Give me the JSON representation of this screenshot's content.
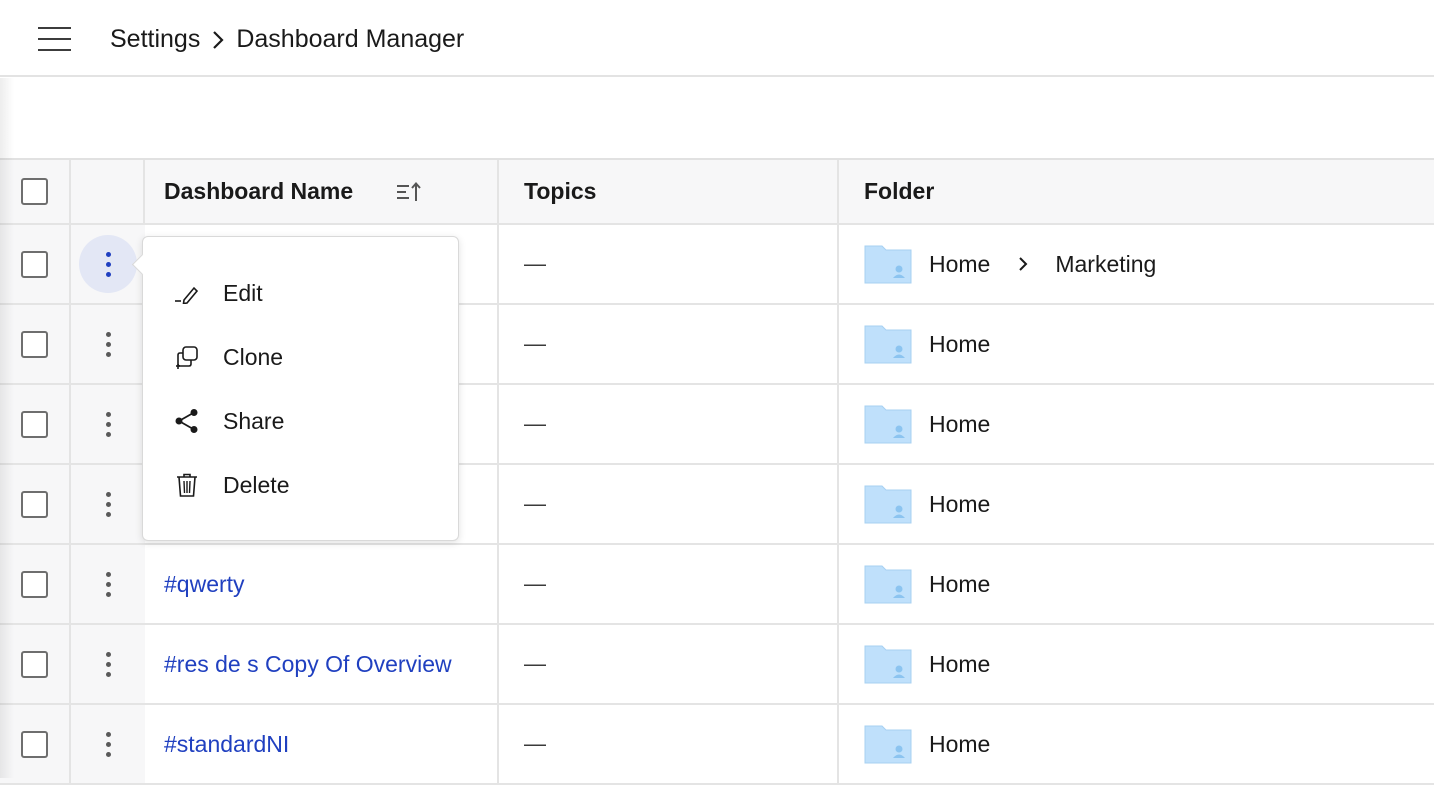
{
  "header": {
    "breadcrumb": [
      "Settings",
      "Dashboard Manager"
    ]
  },
  "table": {
    "columns": {
      "name": "Dashboard Name",
      "topics": "Topics",
      "folder": "Folder"
    },
    "rows": [
      {
        "name": "",
        "topics": "—",
        "folder": [
          "Home",
          "Marketing"
        ]
      },
      {
        "name": "",
        "topics": "—",
        "folder": [
          "Home"
        ]
      },
      {
        "name": "",
        "topics": "—",
        "folder": [
          "Home"
        ]
      },
      {
        "name": "",
        "topics": "—",
        "folder": [
          "Home"
        ]
      },
      {
        "name": "#qwerty",
        "topics": "—",
        "folder": [
          "Home"
        ]
      },
      {
        "name": "#res de s Copy Of Overview",
        "topics": "—",
        "folder": [
          "Home"
        ]
      },
      {
        "name": "#standardNI",
        "topics": "—",
        "folder": [
          "Home"
        ]
      }
    ]
  },
  "context_menu": {
    "items": [
      {
        "label": "Edit",
        "icon": "pencil-icon"
      },
      {
        "label": "Clone",
        "icon": "clone-icon"
      },
      {
        "label": "Share",
        "icon": "share-icon"
      },
      {
        "label": "Delete",
        "icon": "trash-icon"
      }
    ]
  },
  "colors": {
    "link": "#2040c0",
    "active_kebab_bg": "#e3e7f5",
    "folder": "#bfe0fb"
  }
}
